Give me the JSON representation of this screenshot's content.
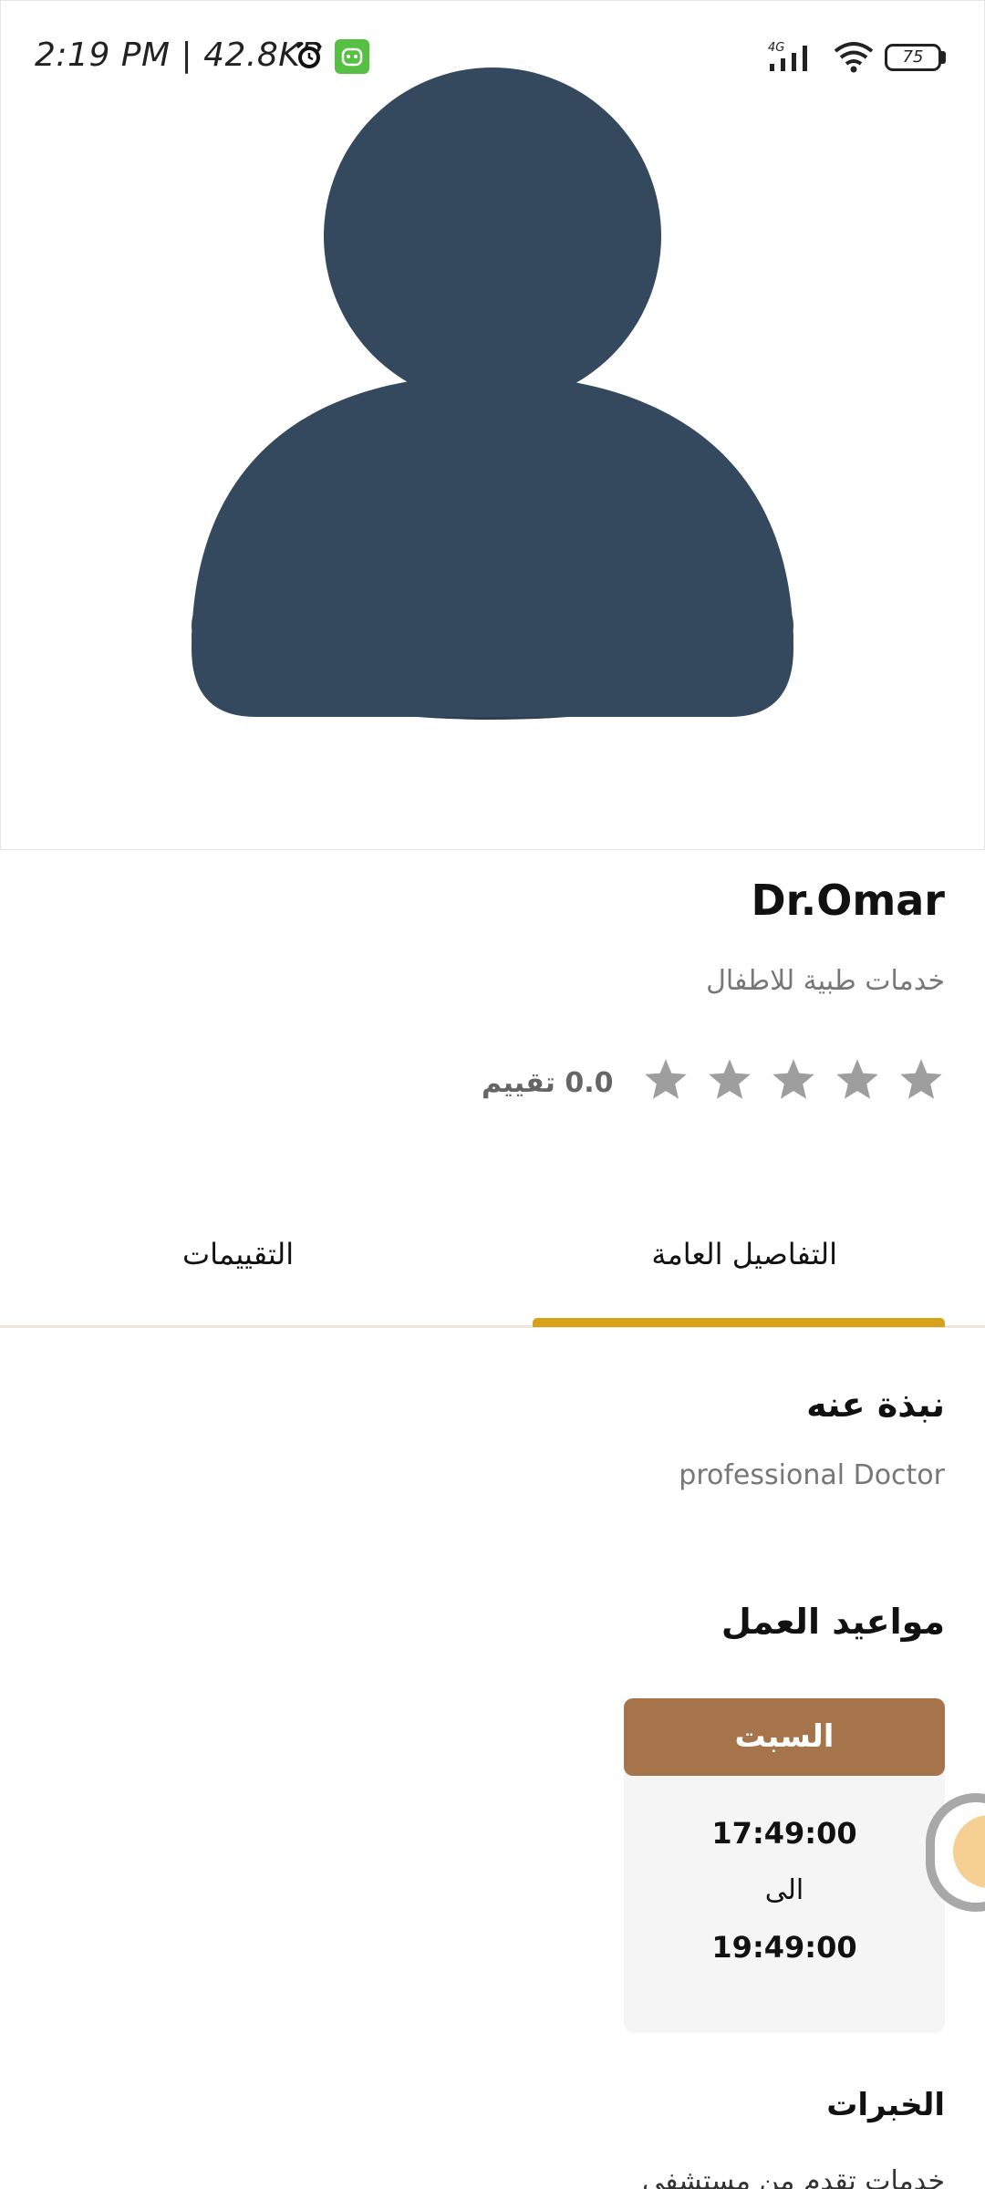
{
  "status_bar": {
    "time": "2:19 PM | 42.8KB",
    "battery": "75",
    "network": "4G"
  },
  "doctor": {
    "name": "Dr.Omar",
    "specialty": "خدمات طبية للاطفال",
    "rating_text": "0.0 تقييم",
    "stars": 5,
    "rating_value": 0.0
  },
  "tabs": {
    "general": "التفاصيل العامة",
    "reviews": "التقييمات",
    "active": "general"
  },
  "about": {
    "title": "نبذة عنه",
    "text": "professional Doctor"
  },
  "working_hours": {
    "title": "مواعيد العمل",
    "day": "السبت",
    "from": "17:49:00",
    "separator": "الى",
    "to": "19:49:00"
  },
  "experience": {
    "title": "الخبرات",
    "first_line": "خدمات تقدم من مستشفى"
  },
  "colors": {
    "avatar": "#34495e",
    "avatar_shadow": "#2c3e50",
    "accent_tab": "#d5a21a",
    "day_header": "#a6744a",
    "star": "#9e9e9e"
  }
}
